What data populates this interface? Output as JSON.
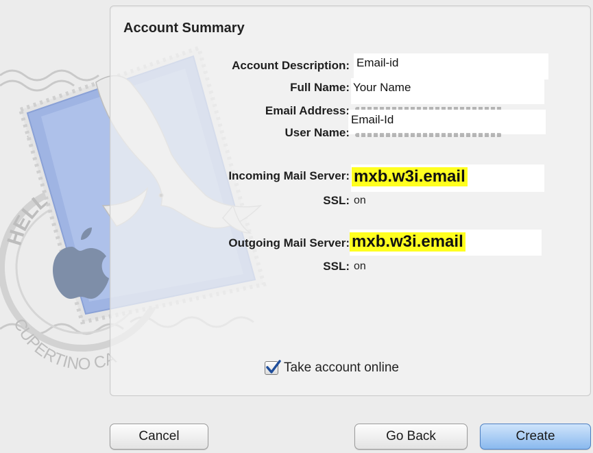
{
  "dialog": {
    "heading": "Account Summary"
  },
  "fields": {
    "account_description_label": "Account Description:",
    "account_description_value": "Email-id",
    "full_name_label": "Full Name:",
    "full_name_value": "Your Name",
    "email_address_label": "Email Address:",
    "user_name_label": "User Name:",
    "user_name_value": "Email-Id",
    "incoming_label": "Incoming Mail Server:",
    "incoming_value": "mxb.w3i.email",
    "incoming_ssl_label": "SSL:",
    "incoming_ssl_value": "on",
    "outgoing_label": "Outgoing Mail Server:",
    "outgoing_value": "mxb.w3i.email",
    "outgoing_ssl_label": "SSL:",
    "outgoing_ssl_value": "on"
  },
  "option": {
    "take_online_label": "Take account online",
    "take_online_checked": true
  },
  "buttons": {
    "cancel": "Cancel",
    "go_back": "Go Back",
    "create": "Create"
  },
  "stamp": {
    "ring_text_top": "HELLO FR",
    "ring_text_bottom": "CUPERTINO CA"
  },
  "colors": {
    "highlight": "#ffff1f",
    "primary_button": "#8ab9ee"
  }
}
